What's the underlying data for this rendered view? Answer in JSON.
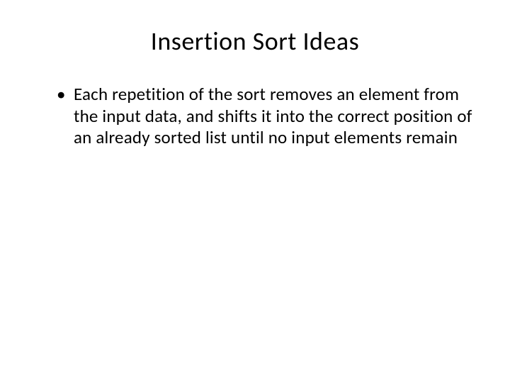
{
  "slide": {
    "title": "Insertion Sort Ideas",
    "bullets": [
      "Each repetition of the sort removes an element from the input data, and shifts it into the correct position of an already sorted list until no input elements remain"
    ]
  }
}
